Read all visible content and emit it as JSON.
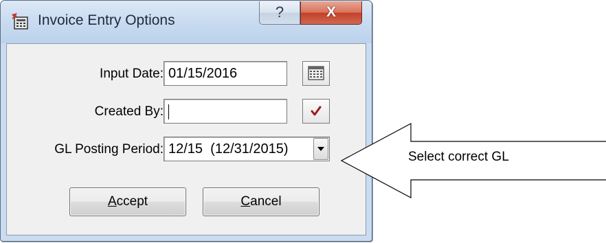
{
  "window": {
    "title": "Invoice Entry Options",
    "help_label": "?",
    "close_label": "X"
  },
  "form": {
    "input_date_label": "Input Date:",
    "input_date_value": "01/15/2016",
    "created_by_label": "Created By:",
    "created_by_value": "",
    "gl_period_label": "GL Posting Period:",
    "gl_period_value": "12/15  (12/31/2015)"
  },
  "buttons": {
    "accept_prefix": "A",
    "accept_rest": "ccept",
    "cancel_prefix": "C",
    "cancel_rest": "ancel"
  },
  "icons": {
    "app": "invoice-app-icon",
    "calendar": "calendar-icon",
    "checkmark": "checkmark-icon",
    "dropdown": "chevron-down-icon"
  },
  "callout": {
    "text": "Select correct GL"
  },
  "colors": {
    "title_bar": "#c6d9f0",
    "close_button": "#c4402a",
    "client_area": "#f0f0f0",
    "checkmark": "#9b1b1b"
  }
}
